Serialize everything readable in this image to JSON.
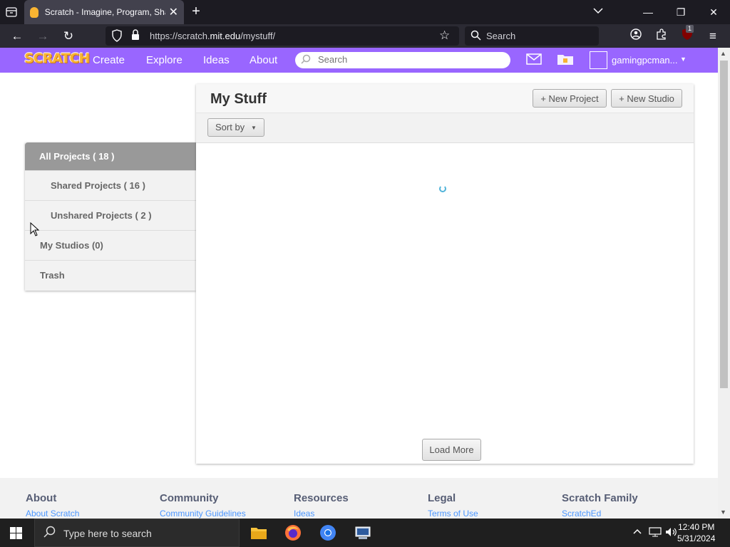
{
  "browser": {
    "tab_title": "Scratch - Imagine, Program, Share",
    "url_domain_prefix": "https://scratch.",
    "url_domain": "mit.edu",
    "url_path": "/mystuff/",
    "search_placeholder": "Search",
    "extension_badge": "1"
  },
  "header": {
    "logo_text": "SCRATCH",
    "nav": [
      "Create",
      "Explore",
      "Ideas",
      "About"
    ],
    "search_placeholder": "Search",
    "username": "gamingpcman..."
  },
  "sidebar": {
    "items": [
      {
        "label": "All Projects ( 18 )"
      },
      {
        "label": "Shared Projects ( 16 )"
      },
      {
        "label": "Unshared Projects ( 2 )"
      },
      {
        "label": "My Studios (0)"
      },
      {
        "label": "Trash"
      }
    ]
  },
  "panel": {
    "title": "My Stuff",
    "new_project": "+ New Project",
    "new_studio": "+ New Studio",
    "sort_by": "Sort by",
    "load_more": "Load More"
  },
  "footer": {
    "columns": [
      {
        "heading": "About",
        "link": "About Scratch"
      },
      {
        "heading": "Community",
        "link": "Community Guidelines"
      },
      {
        "heading": "Resources",
        "link": "Ideas"
      },
      {
        "heading": "Legal",
        "link": "Terms of Use"
      },
      {
        "heading": "Scratch Family",
        "link": "ScratchEd"
      }
    ]
  },
  "taskbar": {
    "search_text": "Type here to search",
    "time": "12:40 PM",
    "date": "5/31/2024"
  },
  "colors": {
    "scratch_purple": "#9966ff",
    "scratch_orange": "#f8b432",
    "link_blue": "#4c97ff"
  }
}
